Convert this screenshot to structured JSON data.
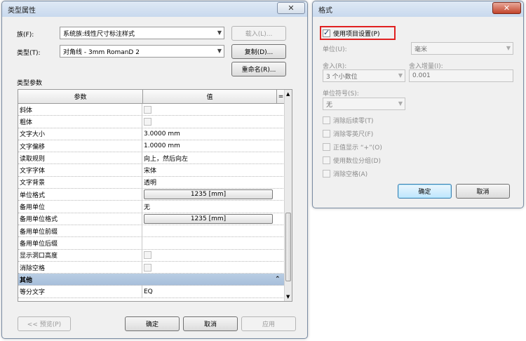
{
  "left_dialog": {
    "title": "类型属性",
    "close_glyph": "✕",
    "family_label": "族(F):",
    "family_value": "系统族:线性尺寸标注样式",
    "load_button": "载入(L)...",
    "type_label": "类型(T):",
    "type_value": "对角线 - 3mm RomanD 2",
    "duplicate_button": "复制(D)...",
    "rename_button": "重命名(R)...",
    "type_params_label": "类型参数",
    "columns": {
      "param": "参数",
      "value": "值",
      "sort": "="
    },
    "rows": [
      {
        "param": "斜体",
        "kind": "checkbox",
        "value": ""
      },
      {
        "param": "粗体",
        "kind": "checkbox",
        "value": ""
      },
      {
        "param": "文字大小",
        "kind": "text",
        "value": "3.0000 mm"
      },
      {
        "param": "文字偏移",
        "kind": "text",
        "value": "1.0000 mm"
      },
      {
        "param": "读取规则",
        "kind": "text",
        "value": "向上，然后向左"
      },
      {
        "param": "文字字体",
        "kind": "text",
        "value": "宋体"
      },
      {
        "param": "文字背景",
        "kind": "text",
        "value": "透明"
      },
      {
        "param": "单位格式",
        "kind": "button",
        "value": "1235 [mm]"
      },
      {
        "param": "备用单位",
        "kind": "text",
        "value": "无"
      },
      {
        "param": "备用单位格式",
        "kind": "button",
        "value": "1235 [mm]"
      },
      {
        "param": "备用单位前缀",
        "kind": "text",
        "value": ""
      },
      {
        "param": "备用单位后缀",
        "kind": "text",
        "value": ""
      },
      {
        "param": "显示洞口高度",
        "kind": "checkbox",
        "value": ""
      },
      {
        "param": "消除空格",
        "kind": "checkbox",
        "value": ""
      },
      {
        "param": "其他",
        "kind": "group",
        "value": ""
      },
      {
        "param": "等分文字",
        "kind": "text",
        "value": "EQ"
      }
    ],
    "group_glyph": "⌃",
    "preview_button": "<< 预览(P)",
    "ok_button": "确定",
    "cancel_button": "取消",
    "apply_button": "应用"
  },
  "right_dialog": {
    "title": "格式",
    "close_glyph": "✕",
    "use_project_settings": "使用项目设置(P)",
    "units_label": "单位(U):",
    "units_value": "毫米",
    "rounding_label": "舍入(R):",
    "rounding_value": "3 个小数位",
    "rounding_increment_label": "舍入增量(I):",
    "rounding_increment_value": "0.001",
    "unit_symbol_label": "单位符号(S):",
    "unit_symbol_value": "无",
    "options": [
      "消除后续零(T)",
      "消除零英尺(F)",
      "正值显示 “+”(O)",
      "使用数位分组(D)",
      "消除空格(A)"
    ],
    "ok_button": "确定",
    "cancel_button": "取消"
  },
  "colors": {
    "highlight_box": "#e02020",
    "group_header": "#b0c6df"
  }
}
